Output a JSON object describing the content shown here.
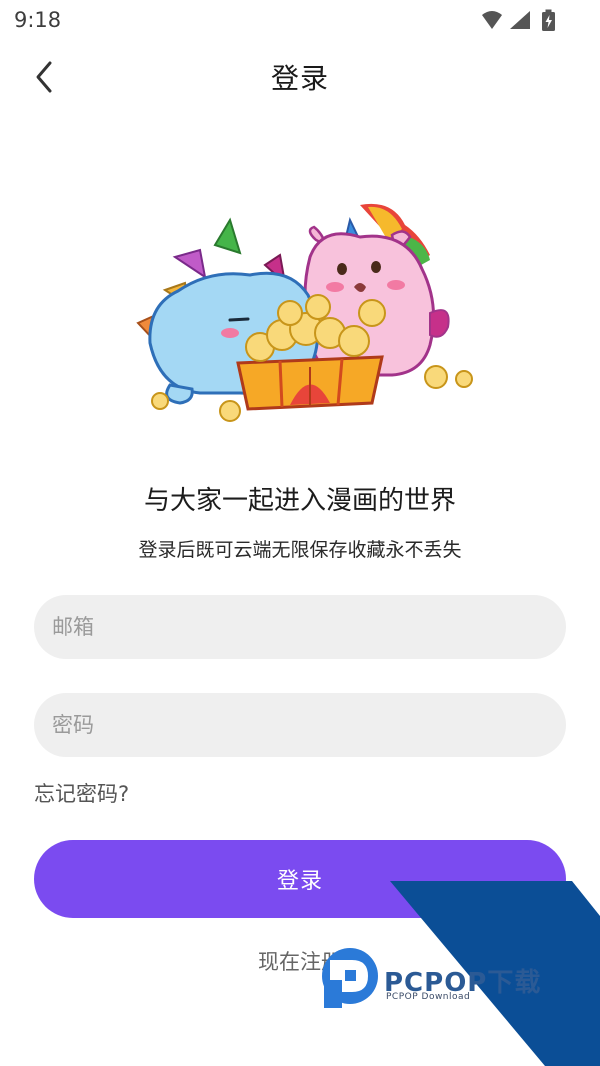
{
  "status_bar": {
    "time": "9:18"
  },
  "header": {
    "title": "登录"
  },
  "intro": {
    "headline": "与大家一起进入漫画的世界",
    "subline": "登录后既可云端无限保存收藏永不丢失"
  },
  "form": {
    "email_placeholder": "邮箱",
    "password_placeholder": "密码",
    "forgot_label": "忘记密码?",
    "login_label": "登录",
    "register_label": "现在注册"
  },
  "watermark": {
    "brand": "PCPOP下载",
    "sub": "PCPOP Download"
  },
  "colors": {
    "accent": "#7b4bf0",
    "field_bg": "#efefef",
    "watermark_blue": "#0b4e96"
  },
  "icons": {
    "back": "chevron-left-icon",
    "wifi": "wifi-icon",
    "signal": "signal-icon",
    "battery": "battery-icon"
  }
}
